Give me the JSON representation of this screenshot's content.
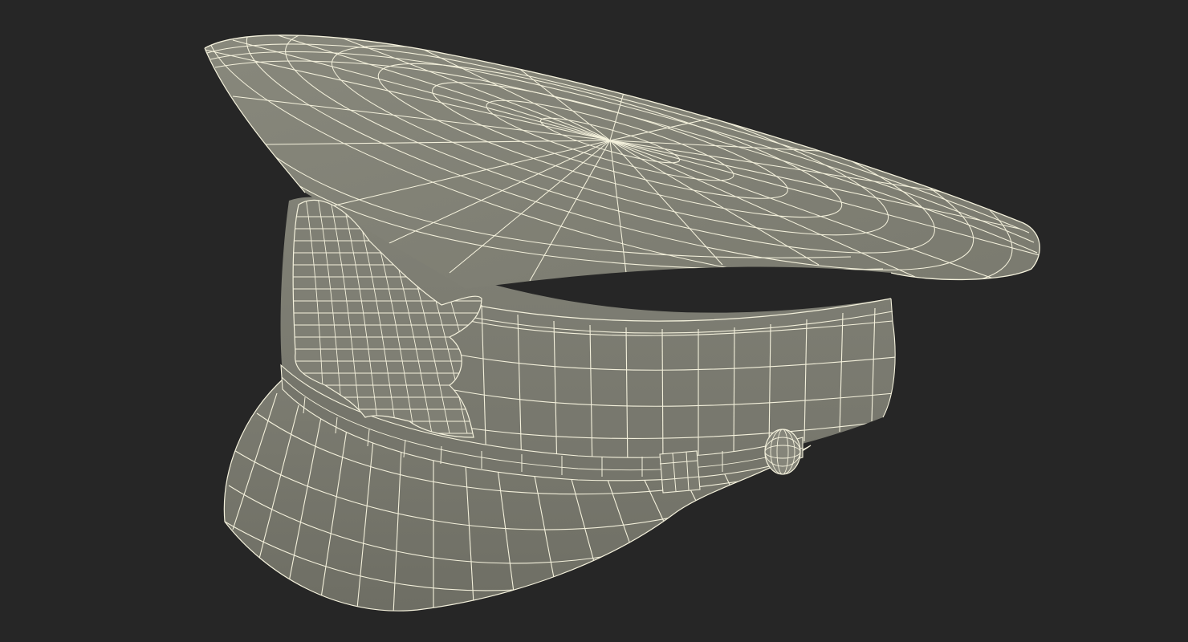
{
  "scene": {
    "subject": "peaked-cap-wireframe",
    "colors": {
      "background": "#262626",
      "surface": "#7e7e72",
      "surface_dark": "#6c6c62",
      "surface_light": "#8d8d81",
      "wire": "#f4f1dc"
    },
    "parts": [
      "crown",
      "band",
      "visor",
      "badge",
      "chin-strap",
      "strap-button",
      "strap-buckle"
    ]
  }
}
